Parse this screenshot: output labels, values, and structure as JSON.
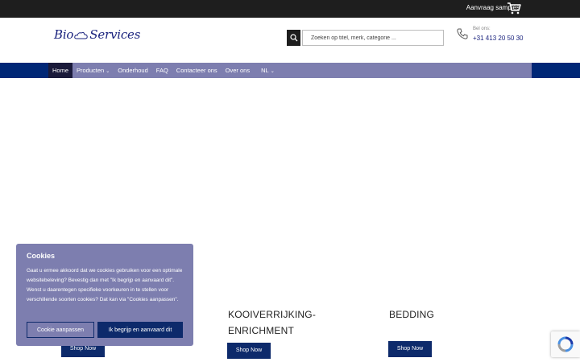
{
  "topbar": {
    "samples_label": "Aanvraag samples"
  },
  "header": {
    "logo_left": "Bio",
    "logo_right": "Services",
    "search": {
      "placeholder": "Zoeken op titel, merk, categorie ..."
    },
    "call_label": "Bel ons:",
    "phone": "+31 413 20 50 30"
  },
  "nav": {
    "items": [
      {
        "label": "Home",
        "active": true
      },
      {
        "label": "Producten",
        "dropdown": true
      },
      {
        "label": "Onderhoud"
      },
      {
        "label": "FAQ"
      },
      {
        "label": "Contacteer ons"
      },
      {
        "label": "Over ons"
      },
      {
        "label": "NL",
        "dropdown": true
      }
    ]
  },
  "categories": [
    {
      "title": "KOOIVERRIJKING-",
      "title2": "ENRICHMENT",
      "button": "Shop Now"
    },
    {
      "title": "BEDDING",
      "button": "Shop Now"
    }
  ],
  "hidden_shop_button": "Shop Now",
  "cookie": {
    "title": "Cookies",
    "text": "Gaat u ermee akkoord dat we cookies gebruiken voor een optimale websitebeleving? Bevestig dan met \"Ik begrijp en aanvaard dit\". Wenst u daarentegen specifieke voorkeuren in te stellen voor verschillende soorten cookies? Dat kan via \"Cookies aanpassen\".",
    "customize_button": "Cookie aanpassen",
    "accept_button": "Ik begrijp en aanvaard dit"
  },
  "colors": {
    "topbar": "#1e1e1e",
    "nav_band": "#002776",
    "nav": "#7d7eaf",
    "nav_active": "#1a1a3a",
    "button": "#0d2a6b",
    "cookie_bg": "#7d7eaf"
  },
  "icons": [
    "cart-icon",
    "cloud-logo-icon",
    "search-icon",
    "phone-icon",
    "chevron-down-icon",
    "recaptcha-icon"
  ]
}
